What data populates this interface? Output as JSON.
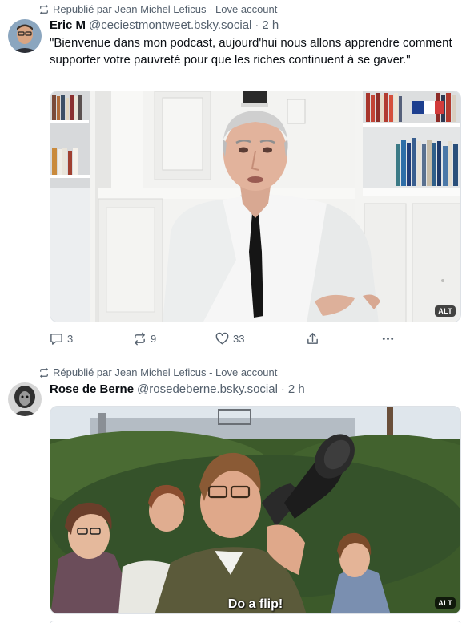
{
  "posts": [
    {
      "repost_label": "Republié par Jean Michel Leficus - Love account",
      "author_name": "Eric M",
      "author_handle": "@ceciestmontweet.bsky.social",
      "separator": "·",
      "time": "2 h",
      "text": "\"Bienvenue dans mon podcast, aujourd'hui nous allons apprendre comment supporter votre pauvreté pour que les riches continuent à se gaver.\"",
      "alt_badge": "ALT",
      "actions": {
        "reply_count": "3",
        "repost_count": "9",
        "like_count": "33"
      }
    },
    {
      "repost_label": "Républié par Jean Michel Leficus - Love account",
      "author_name": "Rose de Berne",
      "author_handle": "@rosedeberne.bsky.social",
      "separator": "·",
      "time": "2 h",
      "caption": "Do a flip!",
      "alt_badge": "ALT"
    }
  ],
  "icons": {
    "repost": "repost-icon",
    "reply": "reply-icon",
    "like": "heart-icon",
    "share": "share-icon",
    "more": "more-icon"
  },
  "colors": {
    "muted_text": "#55616e",
    "primary_text": "#0b0f14",
    "divider": "#e5e8ec"
  }
}
